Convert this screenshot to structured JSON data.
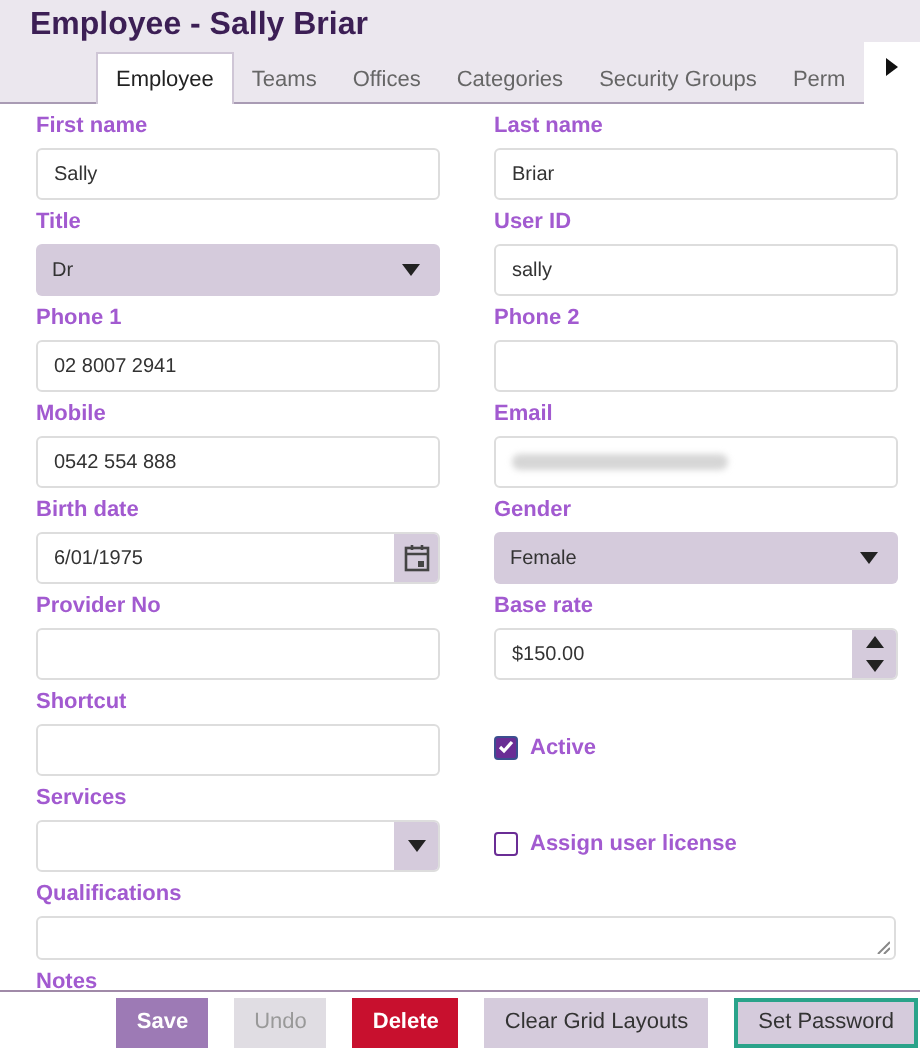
{
  "window": {
    "title": "Employee - Sally Briar"
  },
  "tabs": [
    {
      "label": "Employee",
      "selected": true
    },
    {
      "label": "Teams",
      "selected": false
    },
    {
      "label": "Offices",
      "selected": false
    },
    {
      "label": "Categories",
      "selected": false
    },
    {
      "label": "Security Groups",
      "selected": false
    },
    {
      "label": "Perm",
      "selected": false
    }
  ],
  "fields": [
    {
      "kind": "text",
      "label": "First name",
      "value": "Sally"
    },
    {
      "kind": "text",
      "label": "Last name",
      "value": "Briar"
    },
    {
      "kind": "select",
      "label": "Title",
      "value": "Dr"
    },
    {
      "kind": "text",
      "label": "User ID",
      "value": "sally"
    },
    {
      "kind": "text",
      "label": "Phone 1",
      "value": "02 8007 2941"
    },
    {
      "kind": "text",
      "label": "Phone 2"
    },
    {
      "kind": "text",
      "label": "Mobile",
      "value": "0542 554 888"
    },
    {
      "kind": "redacted",
      "label": "Email"
    },
    {
      "kind": "date",
      "label": "Birth date",
      "value": "6/01/1975"
    },
    {
      "kind": "select",
      "label": "Gender",
      "value": "Female"
    },
    {
      "kind": "text",
      "label": "Provider No"
    },
    {
      "kind": "number",
      "label": "Base rate",
      "value": "$150.00"
    },
    {
      "kind": "text",
      "label": "Shortcut"
    },
    {
      "kind": "checkbox",
      "label": "Active",
      "checked": true
    },
    {
      "kind": "combo",
      "label": "Services"
    },
    {
      "kind": "checkbox",
      "label": "Assign user license",
      "checked": false
    },
    {
      "kind": "textarea",
      "label": "Qualifications"
    },
    {
      "kind": "label",
      "label": "Notes"
    }
  ],
  "buttons": [
    {
      "label": "Save",
      "kind": "primary"
    },
    {
      "label": "Undo",
      "kind": "disabled"
    },
    {
      "label": "Delete",
      "kind": "danger"
    },
    {
      "label": "Clear Grid Layouts",
      "kind": "secondary"
    },
    {
      "label": "Set Password",
      "kind": "outlined"
    }
  ]
}
